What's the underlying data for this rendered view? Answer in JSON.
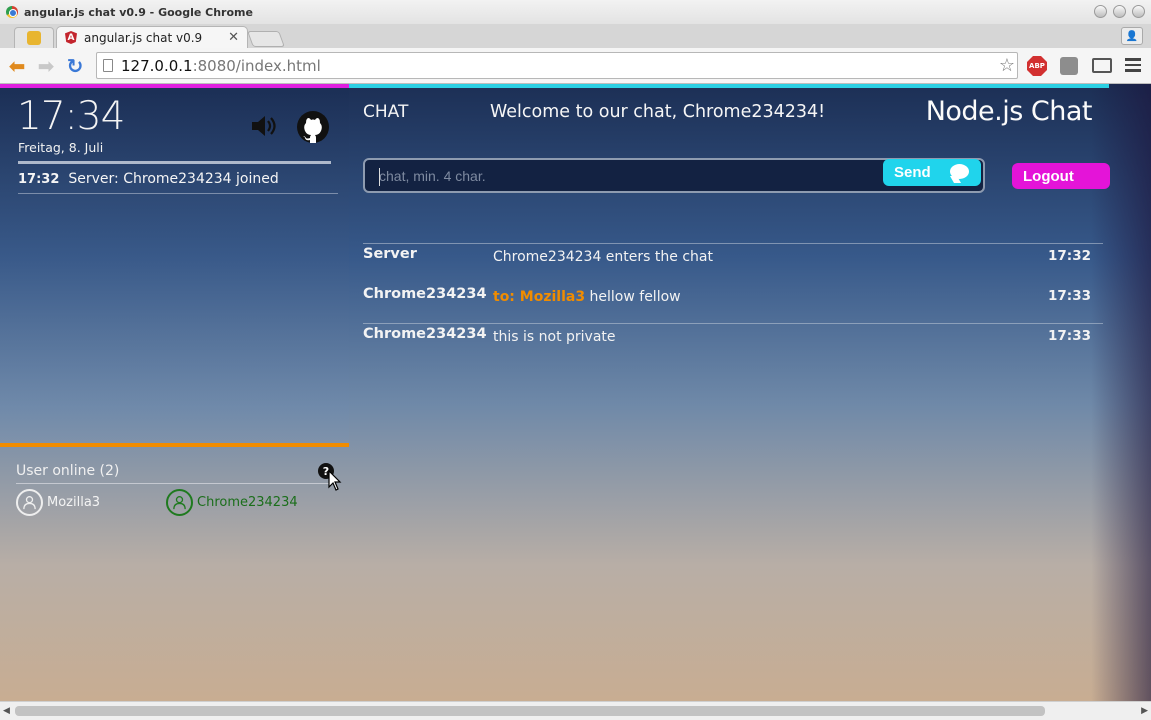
{
  "window": {
    "title": "angular.js chat v0.9 - Google Chrome"
  },
  "tabs": [
    {
      "label": "angular.js chat v0.9"
    }
  ],
  "address": {
    "host": "127.0.0.1",
    "path": ":8080/index.html"
  },
  "extensions": {
    "abp": "ABP"
  },
  "sidebar": {
    "clock": "17:34",
    "date": "Freitag, 8. Juli",
    "system_message": {
      "time": "17:32",
      "text": "Server: Chrome234234 joined"
    },
    "users_heading": "User online (2)",
    "help": "?",
    "users": [
      {
        "name": "Mozilla3",
        "is_self": false
      },
      {
        "name": "Chrome234234",
        "is_self": true
      }
    ]
  },
  "header": {
    "section": "CHAT",
    "welcome": "Welcome to our chat, Chrome234234!",
    "brand": "Node.js Chat"
  },
  "composer": {
    "placeholder": "chat, min. 4 char.",
    "send_label": "Send",
    "logout_label": "Logout"
  },
  "messages": [
    {
      "from": "Server",
      "to": "",
      "text": "Chrome234234 enters the chat",
      "time": "17:32"
    },
    {
      "from": "Chrome234234",
      "to": "to: Mozilla3",
      "text": " hellow fellow",
      "time": "17:33"
    },
    {
      "from": "Chrome234234",
      "to": "",
      "text": "this is not private",
      "time": "17:33"
    }
  ],
  "colors": {
    "accent_magenta": "#e01ee0",
    "accent_cyan": "#2ad0e4",
    "accent_orange": "#f08c00",
    "self_green": "#1b6e1b"
  }
}
